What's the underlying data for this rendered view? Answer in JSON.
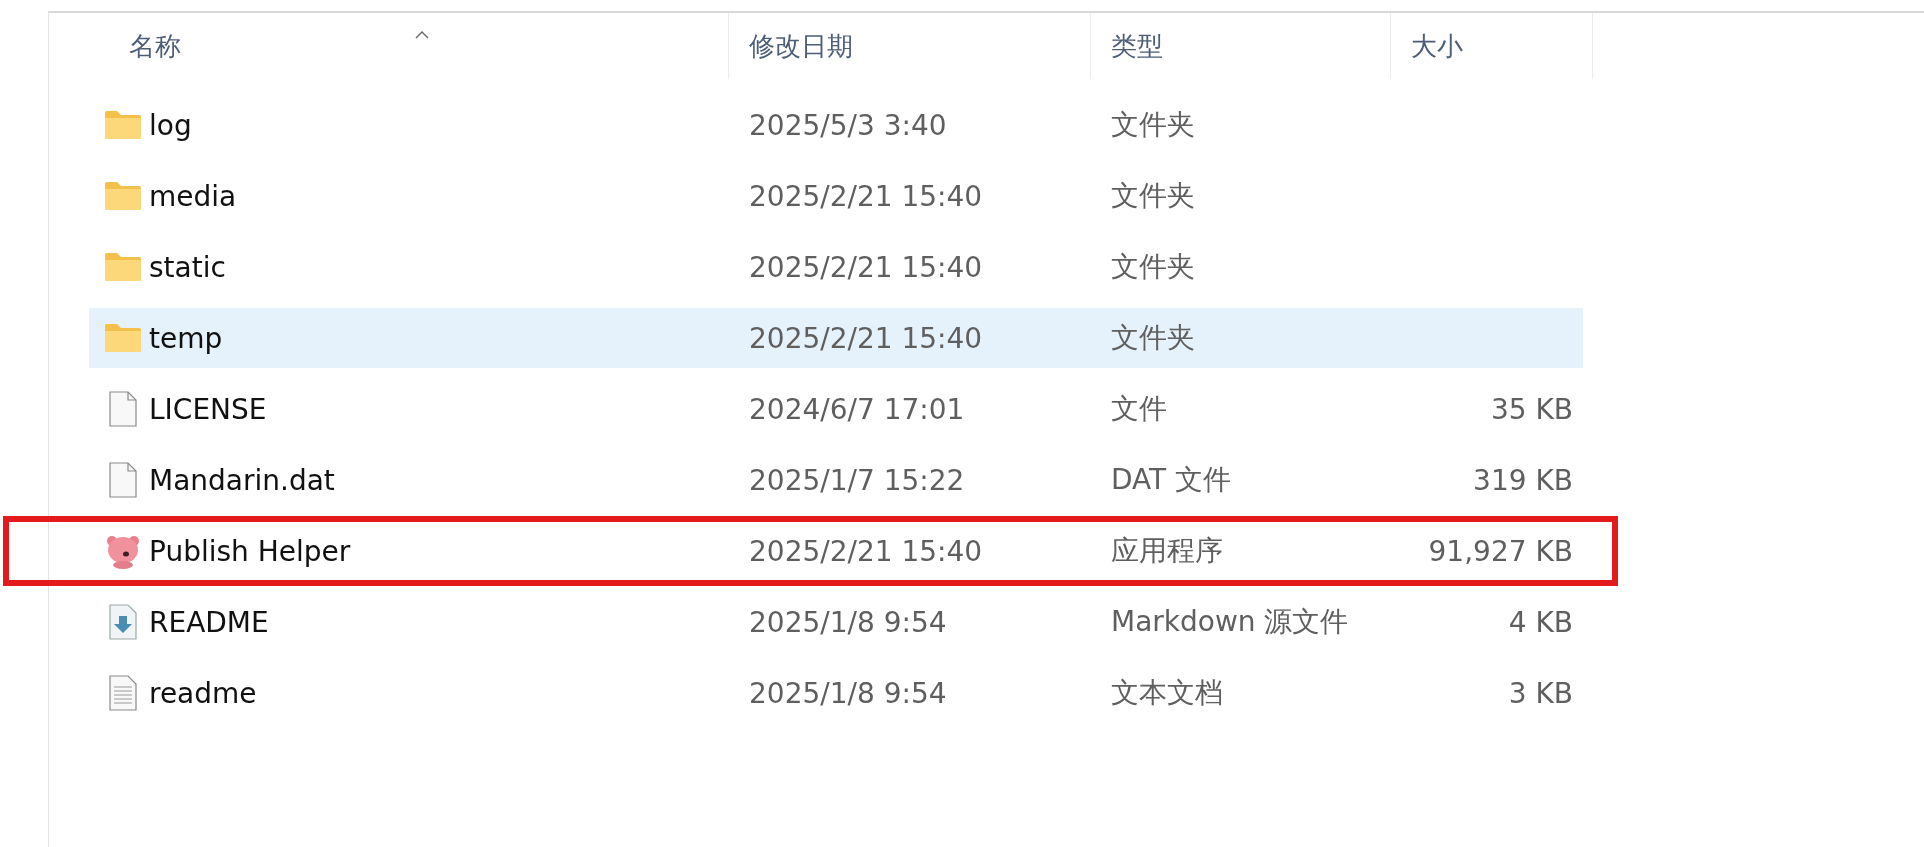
{
  "columns": [
    {
      "label": "名称",
      "sorted_ascending": true
    },
    {
      "label": "修改日期",
      "sorted_ascending": false
    },
    {
      "label": "类型",
      "sorted_ascending": false
    },
    {
      "label": "大小",
      "sorted_ascending": false
    }
  ],
  "rows": [
    {
      "kind": "folder",
      "name": "log",
      "date": "2025/5/3 3:40",
      "type": "文件夹",
      "selected": false,
      "marked": false
    },
    {
      "kind": "folder",
      "name": "media",
      "date": "2025/2/21 15:40",
      "type": "文件夹",
      "selected": false,
      "marked": false
    },
    {
      "kind": "folder",
      "name": "static",
      "date": "2025/2/21 15:40",
      "type": "文件夹",
      "selected": false,
      "marked": false
    },
    {
      "kind": "folder",
      "name": "temp",
      "date": "2025/2/21 15:40",
      "type": "文件夹",
      "selected": true,
      "marked": false
    },
    {
      "kind": "file",
      "name": "LICENSE",
      "date": "2024/6/7 17:01",
      "type": "文件",
      "size": "35 KB",
      "selected": false,
      "marked": false
    },
    {
      "kind": "file",
      "name": "Mandarin.dat",
      "date": "2025/1/7 15:22",
      "type": "DAT 文件",
      "size": "319 KB",
      "selected": false,
      "marked": false
    },
    {
      "kind": "app",
      "name": "Publish Helper",
      "date": "2025/2/21 15:40",
      "type": "应用程序",
      "size": "91,927 KB",
      "selected": false,
      "marked": true
    },
    {
      "kind": "markdown",
      "name": "README",
      "date": "2025/1/8 9:54",
      "type": "Markdown 源文件",
      "size": "4 KB",
      "selected": false,
      "marked": false
    },
    {
      "kind": "text",
      "name": "readme",
      "date": "2025/1/8 9:54",
      "type": "文本文档",
      "size": "3 KB",
      "selected": false,
      "marked": false
    }
  ]
}
